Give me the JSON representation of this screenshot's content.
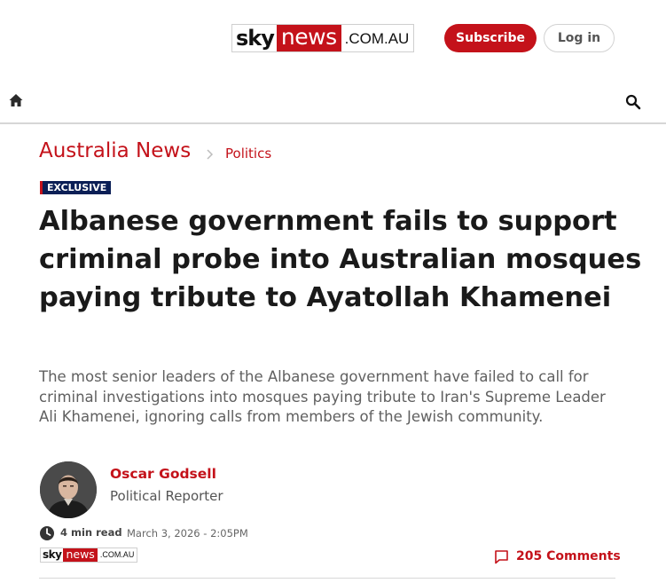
{
  "header": {
    "logo": {
      "sky": "sky",
      "news": "news",
      "domain": ".COM.AU"
    },
    "subscribe_label": "Subscribe",
    "login_label": "Log in",
    "icons": {
      "home": "home-icon",
      "search": "search-icon"
    }
  },
  "breadcrumb": {
    "section": "Australia News",
    "subsection": "Politics"
  },
  "article": {
    "badge": "EXCLUSIVE",
    "headline": "Albanese government fails to support criminal probe into Australian mosques paying tribute to Ayatollah Khamenei",
    "standfirst": "The most senior leaders of the Albanese government have failed to call for criminal investigations into mosques paying tribute to Iran's Supreme Leader Ali Khamenei, ignoring calls from members of the Jewish community.",
    "author": {
      "name": "Oscar Godsell",
      "role": "Political Reporter"
    },
    "read_time": "4 min read",
    "date": "March 3, 2026 - 2:05PM",
    "comments_label": "205 Comments"
  },
  "colors": {
    "brand_red": "#c4121a",
    "badge_navy": "#0b1f56",
    "headline": "#1a1a1a",
    "standfirst": "#606060"
  }
}
